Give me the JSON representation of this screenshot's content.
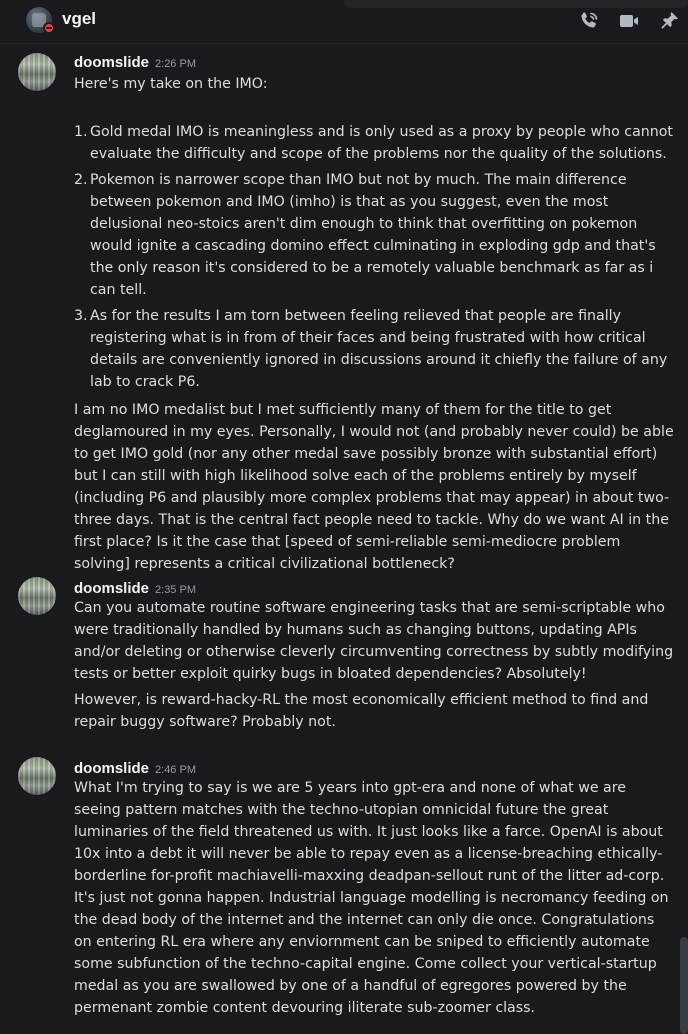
{
  "header": {
    "channel_name": "vgel",
    "avatar_icon": "user-avatar",
    "status": "do-not-disturb",
    "status_color": "#f23f43",
    "icons": [
      "phone-call-icon",
      "video-call-icon",
      "pin-icon"
    ]
  },
  "messages": [
    {
      "author": "doomslide",
      "time": "2:26 PM",
      "intro": "Here's my take on the IMO:",
      "list": [
        {
          "num": "1.",
          "text": "Gold medal IMO is meaningless and is only used as a proxy by people who cannot evaluate the difficulty and scope of the problems nor the quality of the solutions."
        },
        {
          "num": "2.",
          "text": "Pokemon is narrower scope than IMO but not by much. The main difference between pokemon and IMO (imho) is that as you suggest, even the most delusional neo-stoics aren't dim enough to think that overfitting on pokemon would ignite a cascading domino effect culminating in exploding gdp and that's the only reason it's considered to be a remotely valuable benchmark as far as i can tell."
        },
        {
          "num": "3.",
          "text": "As for the results I am torn between feeling relieved that people are finally registering what is in from of their faces and being frustrated with how critical details are conveniently ignored in discussions around it chiefly the failure of any lab to crack P6."
        }
      ],
      "outro": "I am no IMO medalist but I met sufficiently many of them for the title to get deglamoured in my eyes. Personally, I would not (and probably never could) be able to get IMO gold (nor any other medal save possibly bronze with substantial effort) but I can still  with high likelihood solve each of the problems entirely by myself (including P6 and plausibly more complex problems that may appear) in about two-three days. That is the central fact people need to tackle. Why do we want AI in the first place? Is it the case that [speed of semi-reliable semi-mediocre problem solving] represents a critical civilizational bottleneck?"
    },
    {
      "author": "doomslide",
      "time": "2:35 PM",
      "para1": "Can you automate routine software engineering tasks that are semi-scriptable who were traditionally handled by humans such as changing buttons, updating APIs and/or deleting or otherwise cleverly circumventing correctness by subtly modifying tests or better exploit quirky bugs in bloated dependencies? Absolutely!",
      "para2": "However, is reward-hacky-RL the most economically efficient method to find and repair buggy software? Probably not."
    },
    {
      "author": "doomslide",
      "time": "2:46 PM",
      "para1": "What I'm trying to say is we are 5 years into gpt-era and none of what we are seeing pattern matches with the techno-utopian omnicidal future the great luminaries of the field threatened us with. It just looks like a farce. OpenAI is about 10x into a debt it will never be able to repay even as a license-breaching ethically-borderline for-profit machiavelli-maxxing deadpan-sellout runt of the litter ad-corp. It's just not gonna happen. Industrial language modelling is necromancy feeding on the dead body of the internet and the internet can only die once. Congratulations on entering RL era where any enviornment can be sniped to efficiently automate some subfunction of the techno-capital engine. Come collect your vertical-startup medal as you are swallowed by one of a handful of egregores powered by the permenant zombie content devouring iliterate sub-zoomer class."
    }
  ]
}
